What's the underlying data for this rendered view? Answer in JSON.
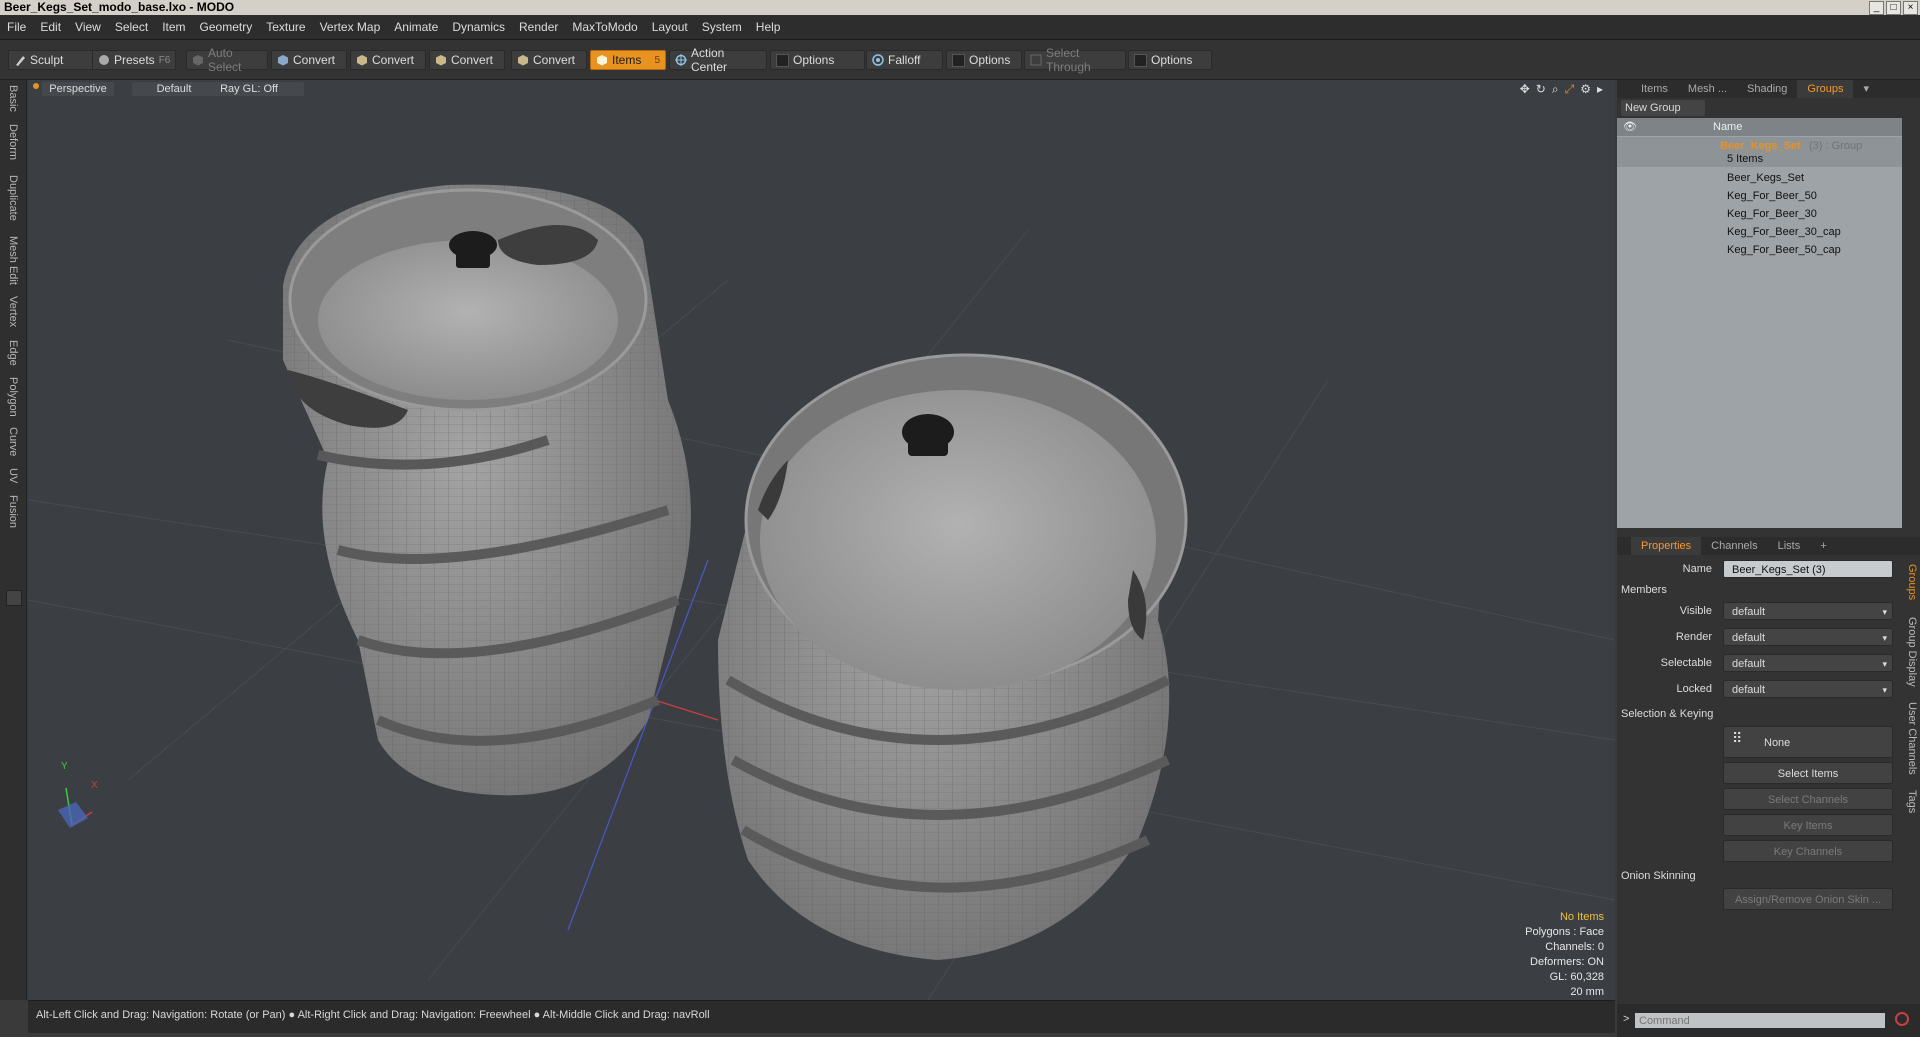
{
  "window": {
    "title": "Beer_Kegs_Set_modo_base.lxo - MODO"
  },
  "menu": [
    "File",
    "Edit",
    "View",
    "Select",
    "Item",
    "Geometry",
    "Texture",
    "Vertex Map",
    "Animate",
    "Dynamics",
    "Render",
    "MaxToModo",
    "Layout",
    "System",
    "Help"
  ],
  "toolbar": {
    "sculpt": "Sculpt",
    "presets": "Presets",
    "presets_key": "F6",
    "auto_select": "Auto Select",
    "convert1": "Convert",
    "convert2": "Convert",
    "convert3": "Convert",
    "convert4": "Convert",
    "items": "Items",
    "items_key": "5",
    "action_center": "Action Center",
    "options1": "Options",
    "falloff": "Falloff",
    "options2": "Options",
    "select_through": "Select Through",
    "options3": "Options"
  },
  "left_tabs": [
    "Basic",
    "Deform",
    "Duplicate",
    "Mesh Edit",
    "Vertex",
    "Edge",
    "Polygon",
    "Curve",
    "UV",
    "Fusion"
  ],
  "viewport": {
    "view": "Perspective",
    "shading": "Default",
    "raygl": "Ray GL: Off",
    "info": {
      "items": "No Items",
      "polygons": "Polygons : Face",
      "channels": "Channels: 0",
      "deformers": "Deformers: ON",
      "gl": "GL: 60,328",
      "scale": "20 mm"
    },
    "axes": {
      "x": "X",
      "y": "Y"
    }
  },
  "status": {
    "text": "Alt-Left Click and Drag: Navigation: Rotate (or Pan) ● Alt-Right Click and Drag: Navigation: Freewheel ● Alt-Middle Click and Drag: navRoll"
  },
  "panel_top": {
    "tabs": [
      "Items",
      "Mesh ...",
      "Shading",
      "Groups"
    ],
    "active_tab": "Groups",
    "new_group": "New Group",
    "name_col": "Name",
    "group": {
      "name": "Beer_Kegs_Set",
      "suffix": "(3) : Group",
      "count": "5 Items"
    },
    "children": [
      "Beer_Kegs_Set",
      "Keg_For_Beer_50",
      "Keg_For_Beer_30",
      "Keg_For_Beer_30_cap",
      "Keg_For_Beer_50_cap"
    ]
  },
  "panel_props": {
    "tabs": [
      "Properties",
      "Channels",
      "Lists",
      "+"
    ],
    "name_label": "Name",
    "name_value": "Beer_Kegs_Set (3)",
    "members": "Members",
    "visible_label": "Visible",
    "visible_value": "default",
    "render_label": "Render",
    "render_value": "default",
    "selectable_label": "Selectable",
    "selectable_value": "default",
    "locked_label": "Locked",
    "locked_value": "default",
    "selection_keying": "Selection & Keying",
    "none": "None",
    "select_items": "Select Items",
    "select_channels": "Select Channels",
    "key_items": "Key Items",
    "key_channels": "Key Channels",
    "onion": "Onion Skinning",
    "assign_onion": "Assign/Remove Onion Skin ...",
    "side_tabs": [
      "Groups",
      "Group Display",
      "User Channels",
      "Tags"
    ]
  },
  "command": {
    "placeholder": "Command"
  },
  "colors": {
    "accent": "#e8921f",
    "viewport": "#3b3f44",
    "tree_bg": "#9ea3a7"
  }
}
